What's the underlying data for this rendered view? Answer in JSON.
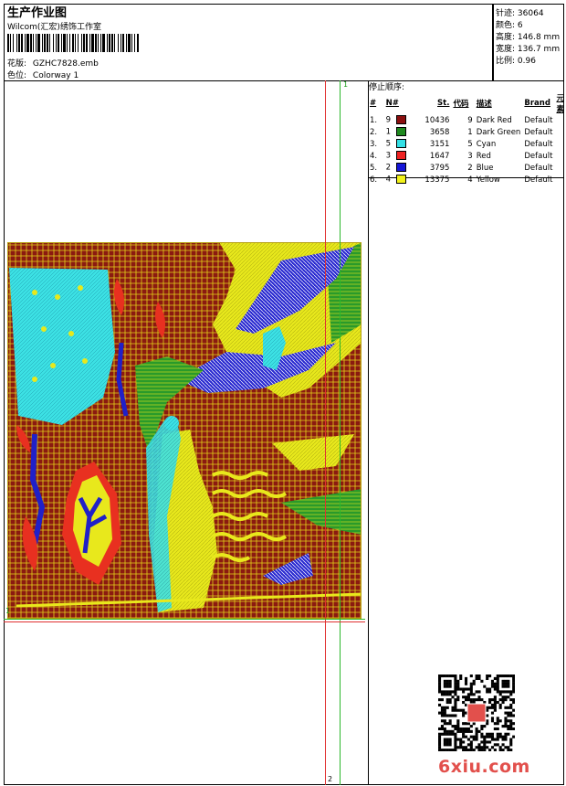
{
  "header": {
    "title": "生产作业图",
    "company": "Wilcom(汇宏)绣饰工作室",
    "design_label": "花版:",
    "design_value": "GZHC7828.emb",
    "colorway_label": "色位:",
    "colorway_value": "Colorway 1"
  },
  "stats": [
    {
      "label": "针迹",
      "value": "36064"
    },
    {
      "label": "颜色",
      "value": "6"
    },
    {
      "label": "高度",
      "value": "146.8 mm"
    },
    {
      "label": "宽度",
      "value": "136.7 mm"
    },
    {
      "label": "比例",
      "value": "0.96"
    }
  ],
  "stop_sequence": {
    "title": "停止顺序:",
    "columns": [
      "#",
      "N#",
      "St.",
      "代码",
      "描述",
      "Brand",
      "元素"
    ],
    "rows": [
      {
        "index": "1.",
        "needle": "9",
        "stitches": "10436",
        "code": "9",
        "description": "Dark Red",
        "brand": "Default",
        "color": "#8b0f0f"
      },
      {
        "index": "2.",
        "needle": "1",
        "stitches": "3658",
        "code": "1",
        "description": "Dark Green",
        "brand": "Default",
        "color": "#1f8a1f"
      },
      {
        "index": "3.",
        "needle": "5",
        "stitches": "3151",
        "code": "5",
        "description": "Cyan",
        "brand": "Default",
        "color": "#33e0e6"
      },
      {
        "index": "4.",
        "needle": "3",
        "stitches": "1647",
        "code": "3",
        "description": "Red",
        "brand": "Default",
        "color": "#ee2222"
      },
      {
        "index": "5.",
        "needle": "2",
        "stitches": "3795",
        "code": "2",
        "description": "Blue",
        "brand": "Default",
        "color": "#1616d8"
      },
      {
        "index": "6.",
        "needle": "4",
        "stitches": "13375",
        "code": "4",
        "description": "Yellow",
        "brand": "Default",
        "color": "#f2f21a"
      }
    ]
  },
  "guides": {
    "green_1": "1",
    "green_left_1": "1",
    "red_2": "2"
  },
  "watermark": "6xiu.com",
  "colors": {
    "dark_red": "#8b1a10",
    "yellow": "#e8e81c",
    "cyan": "#3ce1e4",
    "blue": "#2020c8",
    "green": "#2a9a2a",
    "red": "#e83020"
  }
}
